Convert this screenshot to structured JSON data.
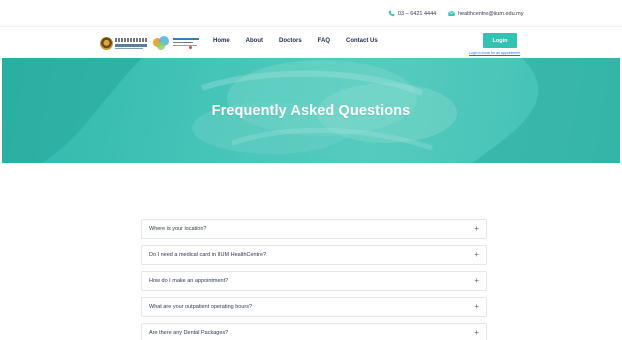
{
  "contact": {
    "phone": "03 – 6421 4444",
    "email": "healthcentre@iium.edu.my",
    "phone_icon": "phone-icon",
    "email_icon": "envelope-icon"
  },
  "nav": {
    "items": [
      "Home",
      "About",
      "Doctors",
      "FAQ",
      "Contact Us"
    ],
    "login_label": "Login",
    "login_hint": "Login to book for an appointment"
  },
  "hero": {
    "title": "Frequently Asked Questions"
  },
  "faq": {
    "items": [
      {
        "question": "Where is your location?"
      },
      {
        "question": "Do I need a medical card in IIUM HealthCentre?"
      },
      {
        "question": "How do I make an appointment?"
      },
      {
        "question": "What are your outpatient operating hours?"
      },
      {
        "question": "Are there any Dental Packages?"
      }
    ],
    "expand_glyph": "+"
  },
  "colors": {
    "accent": "#34c2b2",
    "hero": "#46c4b8",
    "text": "#1f2a44",
    "link": "#2a6fd0"
  }
}
